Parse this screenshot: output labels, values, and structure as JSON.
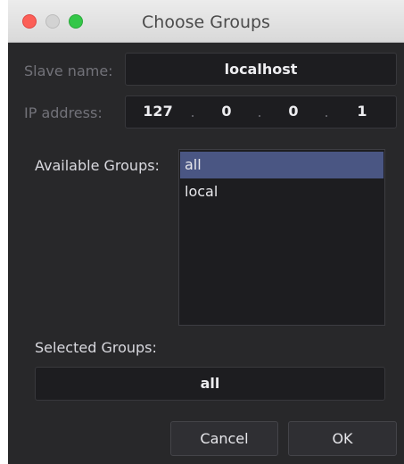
{
  "window": {
    "title": "Choose Groups"
  },
  "slave": {
    "label": "Slave name:",
    "value": "localhost"
  },
  "ip": {
    "label": "IP address:",
    "octets": [
      "127",
      "0",
      "0",
      "1"
    ],
    "separator": "."
  },
  "available": {
    "label": "Available Groups:",
    "items": [
      "all",
      "local"
    ],
    "selected": "all"
  },
  "selected_groups": {
    "label": "Selected Groups:",
    "value": "all"
  },
  "buttons": {
    "cancel": "Cancel",
    "ok": "OK"
  }
}
